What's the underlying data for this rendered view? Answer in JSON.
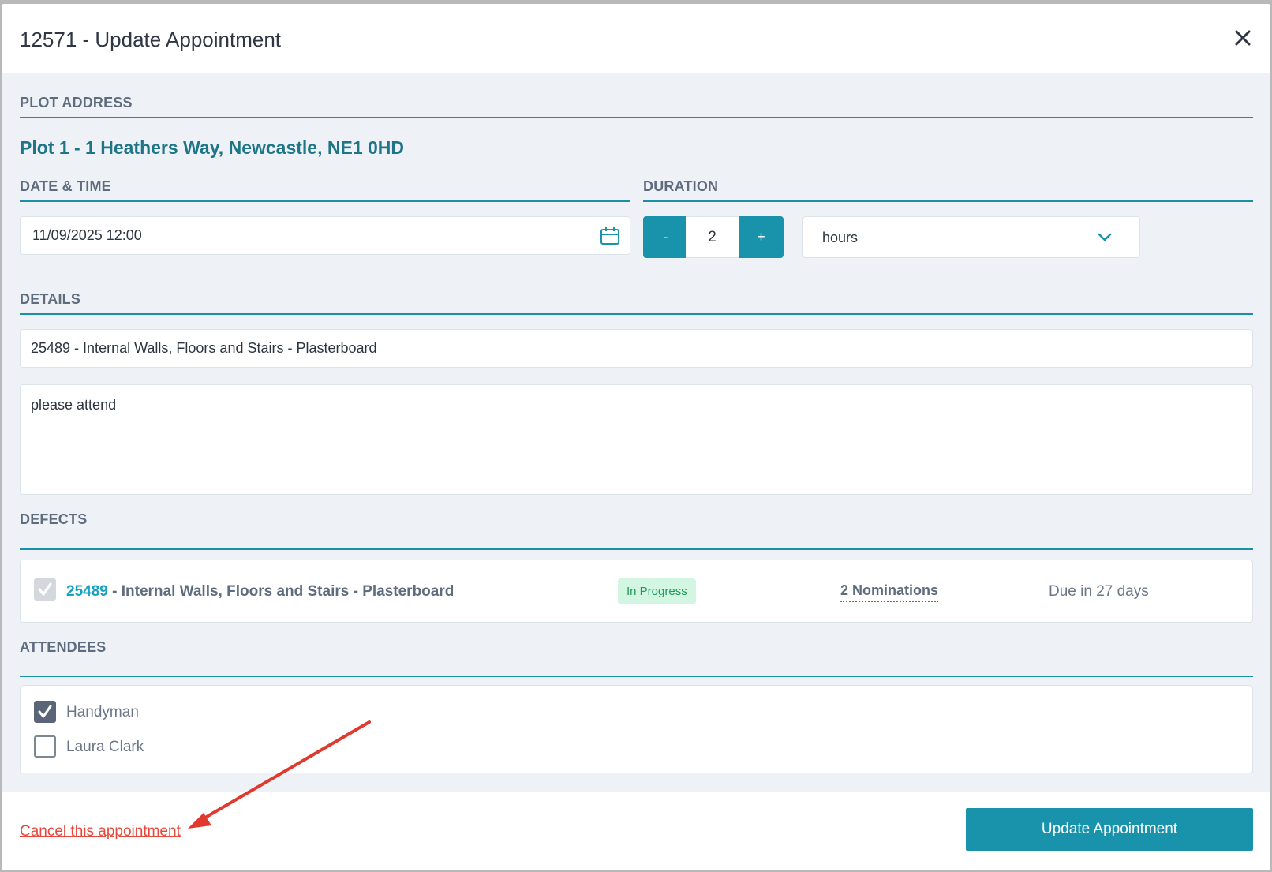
{
  "modal": {
    "title": "12571 - Update Appointment"
  },
  "plot": {
    "label": "PLOT ADDRESS",
    "address": "Plot 1 - 1 Heathers Way, Newcastle, NE1 0HD"
  },
  "datetime": {
    "label": "DATE & TIME",
    "value": "11/09/2025 12:00"
  },
  "duration": {
    "label": "DURATION",
    "decrement": "-",
    "value": "2",
    "increment": "+",
    "unit": "hours"
  },
  "details": {
    "label": "DETAILS",
    "title_value": "25489 - Internal Walls, Floors and Stairs - Plasterboard",
    "notes_value": "please attend"
  },
  "defects": {
    "label": "DEFECTS",
    "items": [
      {
        "id": "25489",
        "description": "- Internal Walls, Floors and Stairs - Plasterboard",
        "status": "In Progress",
        "nominations": "2 Nominations",
        "due": "Due in 27 days"
      }
    ]
  },
  "attendees": {
    "label": "ATTENDEES",
    "items": [
      {
        "name": "Handyman",
        "checked": true
      },
      {
        "name": "Laura Clark",
        "checked": false
      }
    ]
  },
  "footer": {
    "cancel_label": "Cancel this appointment",
    "update_label": "Update Appointment"
  },
  "colors": {
    "accent": "#1993ab",
    "heading": "#1d7587",
    "danger": "#e8473c",
    "status_bg": "#d3f6e3",
    "status_text": "#1d9b5a"
  }
}
